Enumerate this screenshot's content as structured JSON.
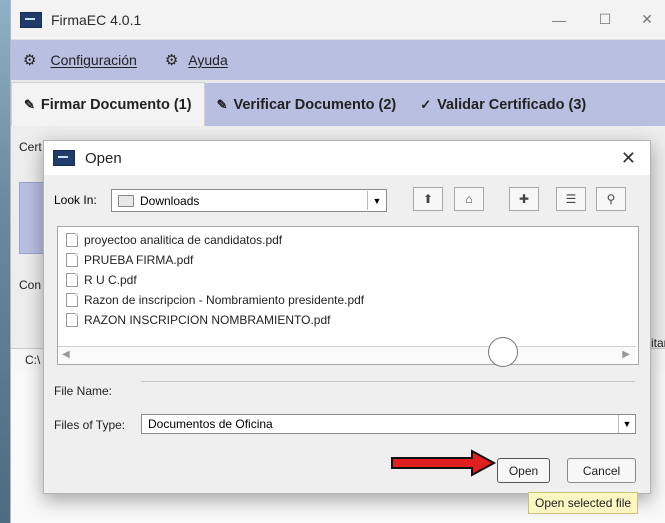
{
  "window": {
    "title": "FirmaEC 4.0.1",
    "controls": {
      "minimize": "—",
      "maximize": "☐",
      "close": "✕"
    }
  },
  "menu": {
    "items": [
      {
        "label": "Configuración",
        "icon": "gear-icon"
      },
      {
        "label": "Ayuda",
        "icon": "gear-icon"
      }
    ]
  },
  "tabs": [
    {
      "label": "Firmar Documento (1)",
      "icon": "sign-doc-icon",
      "active": true
    },
    {
      "label": "Verificar Documento (2)",
      "icon": "verify-doc-icon",
      "active": false
    },
    {
      "label": "Validar Certificado (3)",
      "icon": "check-circle-icon",
      "active": false
    }
  ],
  "background_fragments": {
    "cert_label": "Cert",
    "con_label": "Con",
    "path_label": "C:\\",
    "right_label": "itar"
  },
  "dialog": {
    "title": "Open",
    "look_in_label": "Look In:",
    "look_in_value": "Downloads",
    "files": [
      "proyectoo analitica de candidatos.pdf",
      "PRUEBA FIRMA.pdf",
      "R U C.pdf",
      "Razon de inscripcion - Nombramiento presidente.pdf",
      "RAZON INSCRIPCION NOMBRAMIENTO.pdf"
    ],
    "file_name_label": "File Name:",
    "file_name_value": "",
    "files_of_type_label": "Files of Type:",
    "files_of_type_value": "Documentos de Oficina",
    "open_button": "Open",
    "cancel_button": "Cancel"
  },
  "tooltip": "Open selected file",
  "colors": {
    "menu_bg": "#b8bfe0",
    "arrow_red": "#e02020"
  }
}
